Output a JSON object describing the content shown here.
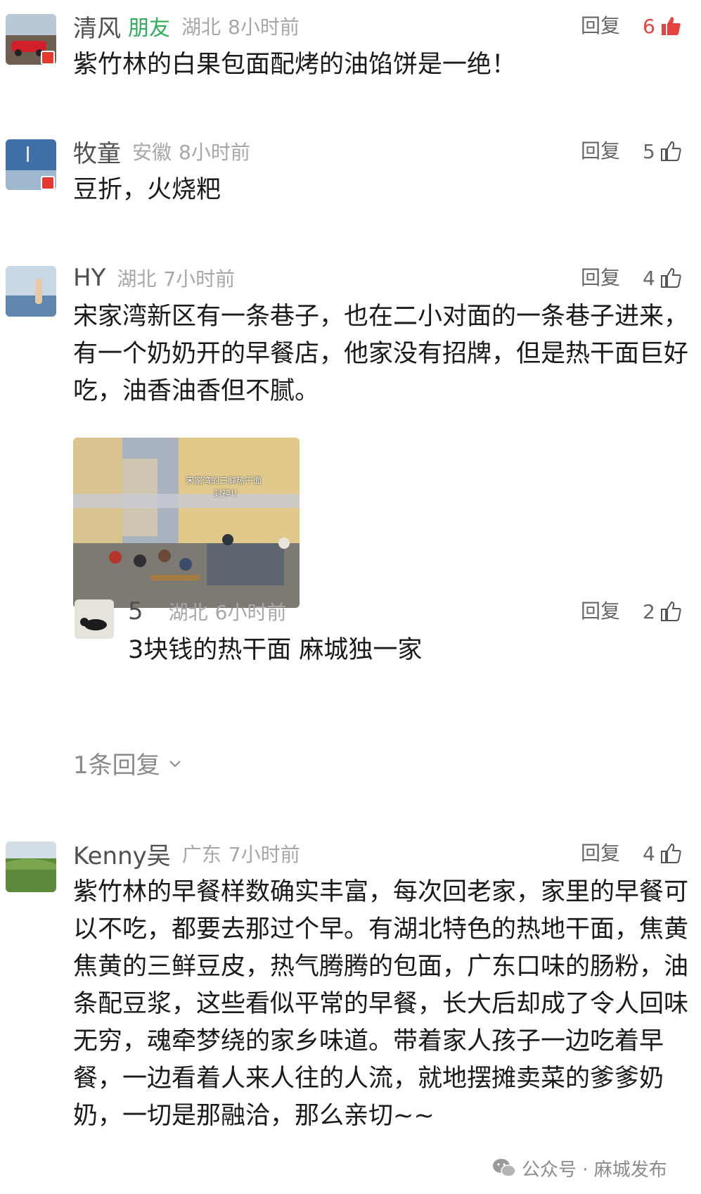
{
  "comments": [
    {
      "name": "清风",
      "tag": "朋友",
      "location": "湖北",
      "time": "8小时前",
      "reply_label": "回复",
      "likes": "6",
      "text": "紫竹林的白果包面配烤的油馅饼是一绝！"
    },
    {
      "name": "牧童",
      "location": "安徽",
      "time": "8小时前",
      "reply_label": "回复",
      "likes": "5",
      "text": "豆折，火烧粑"
    },
    {
      "name": "HY",
      "location": "湖北",
      "time": "7小时前",
      "reply_label": "回复",
      "likes": "4",
      "text": "宋家湾新区有一条巷子，也在二小对面的一条巷子进来，有一个奶奶开的早餐店，他家没有招牌，但是热干面巨好吃，油香油香但不腻。",
      "photo_caption": "宋家湾的三鲜热干面",
      "photo_caption2": "封神!!",
      "reply": {
        "name": "5",
        "location": "湖北",
        "time": "6小时前",
        "reply_label": "回复",
        "likes": "2",
        "text": "3块钱的热干面 麻城独一家"
      },
      "more_replies": "1条回复"
    },
    {
      "name": "Kenny吴",
      "location": "广东",
      "time": "7小时前",
      "reply_label": "回复",
      "likes": "4",
      "text": "紫竹林的早餐样数确实丰富，每次回老家，家里的早餐可以不吃，都要去那过个早。有湖北特色的热地干面，焦黄焦黄的三鲜豆皮，热气腾腾的包面，广东口味的肠粉，油条配豆浆，这些看似平常的早餐，长大后却成了令人回味无穷，魂牵梦绕的家乡味道。带着家人孩子一边吃着早餐，一边看着人来人往的人流，就地摆摊卖菜的爹爹奶奶，一切是那融洽，那么亲切~~"
    }
  ],
  "watermark": "公众号 · 麻城发布",
  "colors": {
    "liked": "#e64340",
    "friend_tag": "#2fae5a",
    "muted": "#a7a7a7"
  }
}
